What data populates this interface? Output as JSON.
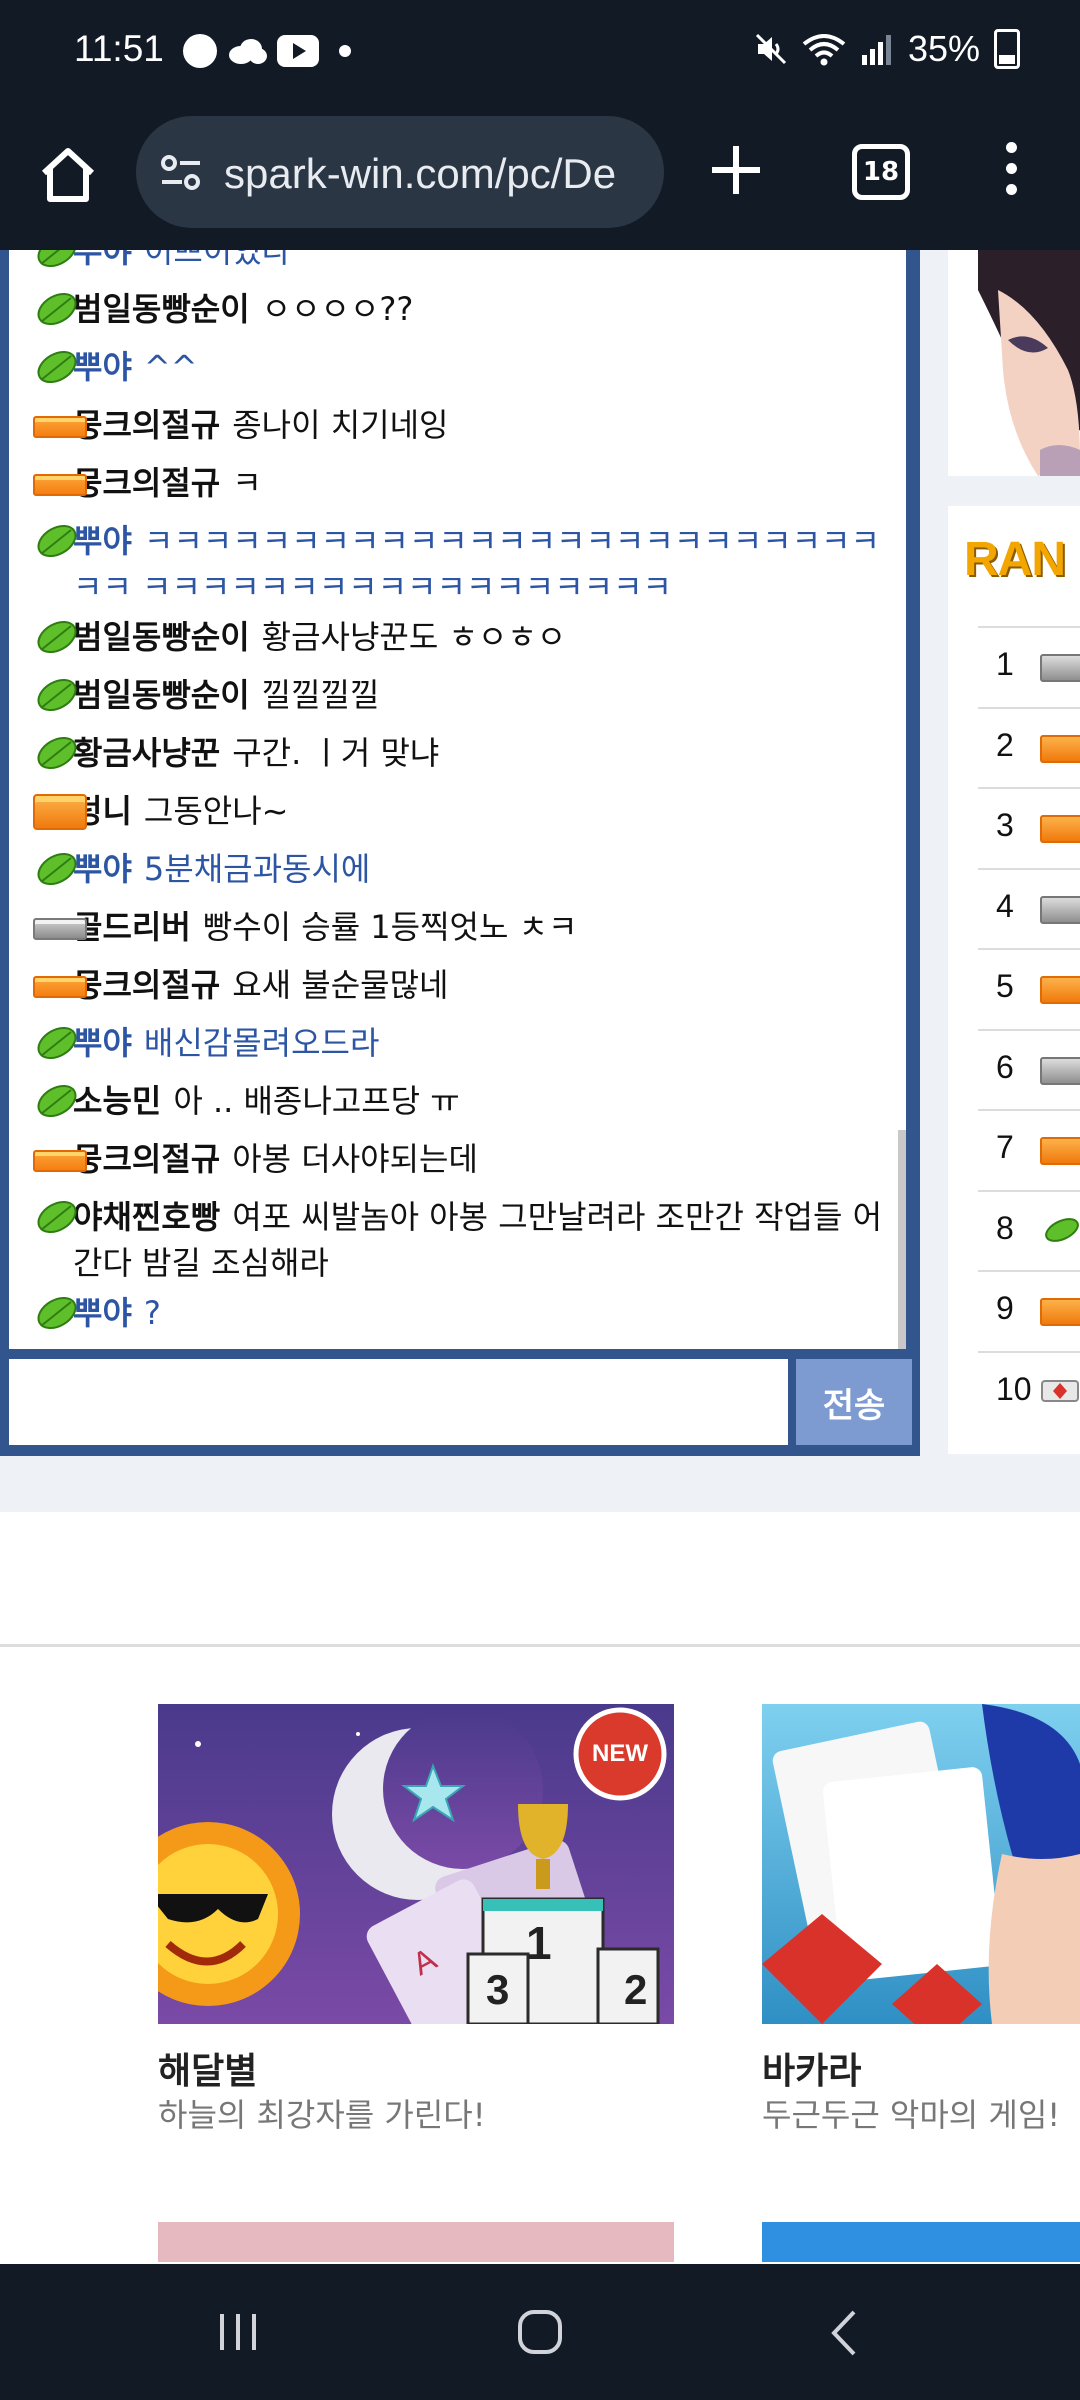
{
  "status_bar": {
    "time": "11:51",
    "battery": "35%",
    "icons": [
      "chat-icon",
      "cloud-icon",
      "youtube-icon",
      "mute-icon",
      "wifi-icon",
      "signal-icon",
      "battery-icon"
    ]
  },
  "browser": {
    "url": "spark-win.com/pc/De",
    "tab_count": "18"
  },
  "chat": {
    "messages": [
      {
        "nick": "범일동빵순이",
        "text": "ㅇㅇㅇㅇ??",
        "badge": "leaf",
        "me": false
      },
      {
        "nick": "뿌야",
        "text": "^^",
        "badge": "leaf",
        "me": true
      },
      {
        "nick": "뭉크의절규",
        "text": "종나이 치기네잉",
        "badge": "gold",
        "me": false
      },
      {
        "nick": "뭉크의절규",
        "text": "ㅋ",
        "badge": "gold",
        "me": false
      },
      {
        "nick": "뿌야",
        "text": "ㅋㅋㅋㅋㅋㅋㅋㅋㅋㅋㅋㅋㅋㅋㅋㅋㅋㅋㅋㅋㅋㅋㅋㅋㅋㅋㅋ ㅋㅋㅋㅋㅋㅋㅋㅋㅋㅋㅋㅋㅋㅋㅋㅋㅋㅋ",
        "badge": "leaf",
        "me": true
      },
      {
        "nick": "범일동빵순이",
        "text": "황금사냥꾼도 ㅎㅇㅎㅇ",
        "badge": "leaf",
        "me": false
      },
      {
        "nick": "범일동빵순이",
        "text": "낄낄낄낄",
        "badge": "leaf",
        "me": false
      },
      {
        "nick": "황금사냥꾼",
        "text": "구간. ㅣ거 맞냐",
        "badge": "leaf",
        "me": false
      },
      {
        "nick": "덩니",
        "text": "그동안나~",
        "badge": "goldbig",
        "me": false
      },
      {
        "nick": "뿌야",
        "text": "5분채금과동시에",
        "badge": "leaf",
        "me": true
      },
      {
        "nick": "골드리버",
        "text": "빵수이 승률 1등찍엇노 ㅊㅋ",
        "badge": "silver",
        "me": false
      },
      {
        "nick": "뭉크의절규",
        "text": "요새 불순물많네",
        "badge": "gold",
        "me": false
      },
      {
        "nick": "뿌야",
        "text": "배신감몰려오드라",
        "badge": "leaf",
        "me": true
      },
      {
        "nick": "소능민",
        "text": "아 .. 배종나고프당 ㅠ",
        "badge": "leaf",
        "me": false
      },
      {
        "nick": "뭉크의절규",
        "text": "아봉 더사야되는데",
        "badge": "gold",
        "me": false
      },
      {
        "nick": "야채찐호빵",
        "text": "여포 씨발놈아 아봉 그만날려라 조만간 작업들 어간다 밤길 조심해라",
        "badge": "leaf",
        "me": false
      },
      {
        "nick": "뿌야",
        "text": "?",
        "badge": "leaf",
        "me": true
      }
    ],
    "partial_top_nick": "뿌야",
    "partial_top_text": "이쁘이었다",
    "send_label": "전송",
    "input_value": ""
  },
  "ranking": {
    "title": "RAN",
    "rows": [
      {
        "rank": "1",
        "badge": "silver"
      },
      {
        "rank": "2",
        "badge": "gold"
      },
      {
        "rank": "3",
        "badge": "gold"
      },
      {
        "rank": "4",
        "badge": "silver"
      },
      {
        "rank": "5",
        "badge": "gold"
      },
      {
        "rank": "6",
        "badge": "silver"
      },
      {
        "rank": "7",
        "badge": "gold"
      },
      {
        "rank": "8",
        "badge": "leaf"
      },
      {
        "rank": "9",
        "badge": "gold"
      },
      {
        "rank": "10",
        "badge": "diamond"
      }
    ]
  },
  "games": [
    {
      "title": "해달별",
      "subtitle": "하늘의 최강자를 가린다!",
      "new_badge": "NEW",
      "podium": [
        "1",
        "2",
        "3"
      ]
    },
    {
      "title": "바카라",
      "subtitle": "두근두근 악마의 게임!"
    }
  ],
  "nav": {
    "icons": [
      "recent-apps-icon",
      "home-icon",
      "back-icon"
    ]
  },
  "colors": {
    "system_bar": "#121a26",
    "chat_frame": "#33558d",
    "my_nick": "#2c55a4",
    "send_button": "#7d9bd1",
    "page_band": "#eef1f5"
  }
}
